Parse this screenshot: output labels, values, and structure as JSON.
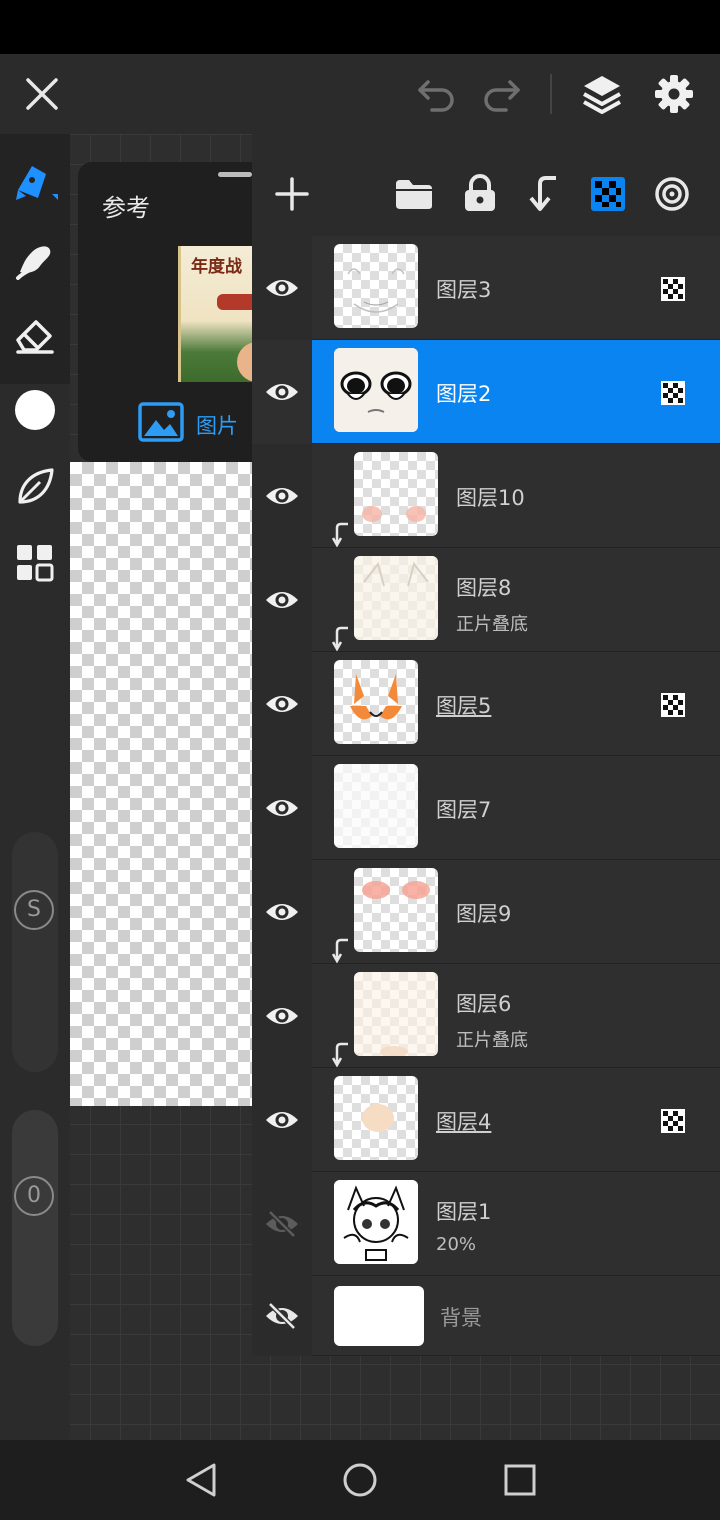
{
  "reference": {
    "title": "参考",
    "tab_label": "图片",
    "thumb_text": "年度战"
  },
  "layers": [
    {
      "name": "图层3",
      "sub": "",
      "clipped": false,
      "selected": false,
      "visible": true,
      "alpha_lock": true,
      "underline": false
    },
    {
      "name": "图层2",
      "sub": "",
      "clipped": false,
      "selected": true,
      "visible": true,
      "alpha_lock": true,
      "underline": false
    },
    {
      "name": "图层10",
      "sub": "",
      "clipped": true,
      "selected": false,
      "visible": true,
      "alpha_lock": false,
      "underline": false
    },
    {
      "name": "图层8",
      "sub": "正片叠底",
      "clipped": true,
      "selected": false,
      "visible": true,
      "alpha_lock": false,
      "underline": false
    },
    {
      "name": "图层5",
      "sub": "",
      "clipped": false,
      "selected": false,
      "visible": true,
      "alpha_lock": true,
      "underline": true
    },
    {
      "name": "图层7",
      "sub": "",
      "clipped": false,
      "selected": false,
      "visible": true,
      "alpha_lock": false,
      "underline": false
    },
    {
      "name": "图层9",
      "sub": "",
      "clipped": true,
      "selected": false,
      "visible": true,
      "alpha_lock": false,
      "underline": false
    },
    {
      "name": "图层6",
      "sub": "正片叠底",
      "clipped": true,
      "selected": false,
      "visible": true,
      "alpha_lock": false,
      "underline": false
    },
    {
      "name": "图层4",
      "sub": "",
      "clipped": false,
      "selected": false,
      "visible": true,
      "alpha_lock": true,
      "underline": true
    },
    {
      "name": "图层1",
      "sub": "20%",
      "clipped": false,
      "selected": false,
      "visible": false,
      "alpha_lock": false,
      "underline": false
    }
  ],
  "background_layer": {
    "name": "背景",
    "visible": false
  },
  "left_tools": {
    "s_button": "S",
    "zero_button": "0"
  },
  "colors": {
    "accent": "#0a84f0",
    "brush_active": "#1e90ff"
  },
  "icons": {
    "close": "close-icon",
    "undo": "undo-icon",
    "redo": "redo-icon",
    "layers": "layers-icon",
    "settings": "gear-icon",
    "add": "plus-icon",
    "folder": "folder-icon",
    "lock": "lock-icon",
    "merge_down": "merge-down-icon",
    "alpha_lock": "alpha-lock-icon",
    "reference": "target-icon"
  }
}
